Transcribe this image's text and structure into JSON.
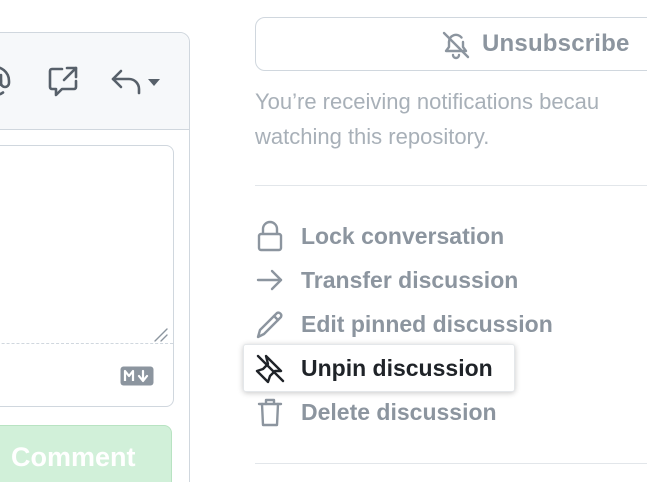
{
  "editor": {
    "toolbar_icons": [
      "mention-icon",
      "cross-reference-icon",
      "reply-icon",
      "chevron-down-icon"
    ],
    "textarea_value": "",
    "markdown_badge_icon": "markdown-icon",
    "comment_label": "Comment"
  },
  "sidebar": {
    "unsubscribe_label": "Unsubscribe",
    "unsubscribe_icon": "bell-slash-icon",
    "notification_line1": "You’re receiving notifications becau",
    "notification_line2": "watching this repository.",
    "actions": [
      {
        "label": "Lock conversation",
        "icon": "lock-icon"
      },
      {
        "label": "Transfer discussion",
        "icon": "arrow-right-icon"
      },
      {
        "label": "Edit pinned discussion",
        "icon": "pencil-icon"
      },
      {
        "label": "Unpin discussion",
        "icon": "pin-slash-icon",
        "highlighted": true
      },
      {
        "label": "Delete discussion",
        "icon": "trash-icon"
      }
    ]
  },
  "colors": {
    "muted_text": "#8c959f",
    "strong_text": "#1f2328",
    "border": "#d0d7de",
    "comment_button_bg": "#d1f0d9"
  }
}
